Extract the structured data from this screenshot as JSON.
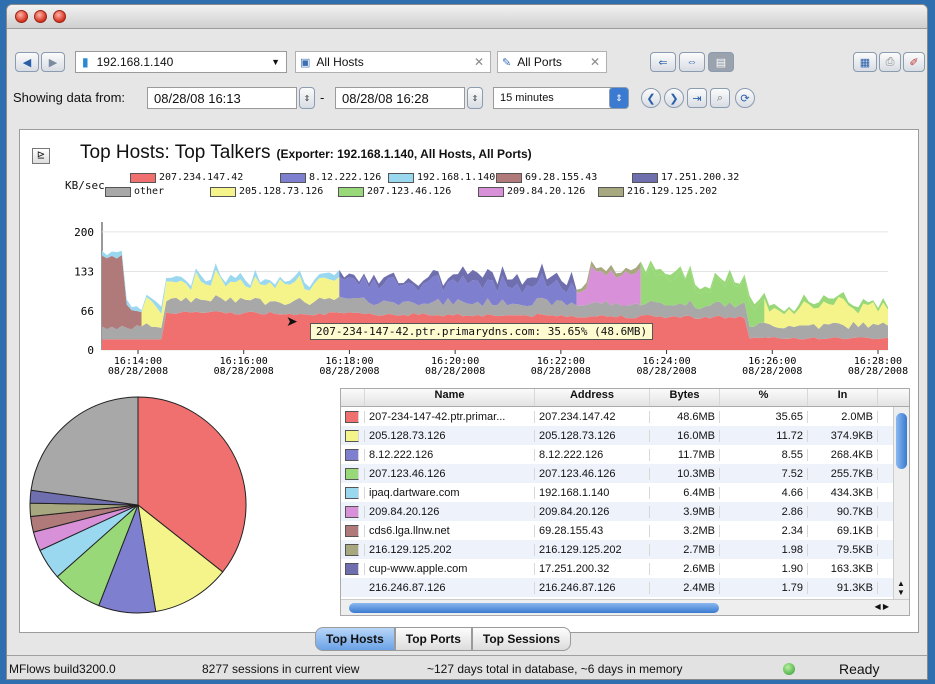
{
  "toolbar": {
    "exporter": "192.168.1.140",
    "hosts_tab": "All Hosts",
    "ports_tab": "All Ports"
  },
  "range": {
    "label": "Showing data from:",
    "from": "08/28/08 16:13",
    "dash": "-",
    "to": "08/28/08 16:28",
    "interval": "15 minutes"
  },
  "report": {
    "title": "Top Hosts: Top Talkers",
    "subtitle": "(Exporter: 192.168.1.140, All Hosts, All Ports)"
  },
  "tooltip": "207-234-147-42.ptr.primarydns.com: 35.65% (48.6MB)",
  "chart_data": {
    "type": "area",
    "ylabel": "KB/sec",
    "yticks": [
      "200",
      "133",
      "66",
      "0"
    ],
    "ylim": [
      0,
      210
    ],
    "x_ticks": [
      {
        "time": "16:14:00",
        "date": "08/28/2008"
      },
      {
        "time": "16:16:00",
        "date": "08/28/2008"
      },
      {
        "time": "16:18:00",
        "date": "08/28/2008"
      },
      {
        "time": "16:20:00",
        "date": "08/28/2008"
      },
      {
        "time": "16:22:00",
        "date": "08/28/2008"
      },
      {
        "time": "16:24:00",
        "date": "08/28/2008"
      },
      {
        "time": "16:26:00",
        "date": "08/28/2008"
      },
      {
        "time": "16:28:00",
        "date": "08/28/2008"
      }
    ],
    "legend_row1": [
      {
        "name": "207.234.147.42",
        "color": "#f07070"
      },
      {
        "name": "8.12.222.126",
        "color": "#7f7fd0"
      },
      {
        "name": "192.168.1.140",
        "color": "#9ad8f0"
      },
      {
        "name": "69.28.155.43",
        "color": "#b07a7a"
      },
      {
        "name": "17.251.200.32",
        "color": "#6f6fb0"
      }
    ],
    "legend_row2": [
      {
        "name": "other",
        "color": "#a8a8a8"
      },
      {
        "name": "205.128.73.126",
        "color": "#f4f48a"
      },
      {
        "name": "207.123.46.126",
        "color": "#98d878"
      },
      {
        "name": "209.84.20.126",
        "color": "#d890d8"
      },
      {
        "name": "216.129.125.202",
        "color": "#a8a880"
      }
    ],
    "pie": [
      {
        "name": "207-234-147-42.ptr.primar...",
        "value": 35.65,
        "color": "#f07070"
      },
      {
        "name": "205.128.73.126",
        "value": 11.72,
        "color": "#f4f48a"
      },
      {
        "name": "8.12.222.126",
        "value": 8.55,
        "color": "#7f7fd0"
      },
      {
        "name": "207.123.46.126",
        "value": 7.52,
        "color": "#98d878"
      },
      {
        "name": "ipaq.dartware.com",
        "value": 4.66,
        "color": "#9ad8f0"
      },
      {
        "name": "209.84.20.126",
        "value": 2.86,
        "color": "#d890d8"
      },
      {
        "name": "cds6.lga.llnw.net",
        "value": 2.34,
        "color": "#b07a7a"
      },
      {
        "name": "216.129.125.202",
        "value": 1.98,
        "color": "#a8a880"
      },
      {
        "name": "cup-www.apple.com",
        "value": 1.9,
        "color": "#6f6fb0"
      },
      {
        "name": "other",
        "value": 22.82,
        "color": "#a8a8a8"
      }
    ]
  },
  "table": {
    "headers": [
      "Name",
      "Address",
      "Bytes",
      "%",
      "In"
    ],
    "rows": [
      {
        "color": "#f07070",
        "name": "207-234-147-42.ptr.primar...",
        "address": "207.234.147.42",
        "bytes": "48.6MB",
        "pct": "35.65",
        "in": "2.0MB"
      },
      {
        "color": "#f4f48a",
        "name": "205.128.73.126",
        "address": "205.128.73.126",
        "bytes": "16.0MB",
        "pct": "11.72",
        "in": "374.9KB"
      },
      {
        "color": "#7f7fd0",
        "name": "8.12.222.126",
        "address": "8.12.222.126",
        "bytes": "11.7MB",
        "pct": "8.55",
        "in": "268.4KB"
      },
      {
        "color": "#98d878",
        "name": "207.123.46.126",
        "address": "207.123.46.126",
        "bytes": "10.3MB",
        "pct": "7.52",
        "in": "255.7KB"
      },
      {
        "color": "#9ad8f0",
        "name": "ipaq.dartware.com",
        "address": "192.168.1.140",
        "bytes": "6.4MB",
        "pct": "4.66",
        "in": "434.3KB"
      },
      {
        "color": "#d890d8",
        "name": "209.84.20.126",
        "address": "209.84.20.126",
        "bytes": "3.9MB",
        "pct": "2.86",
        "in": "90.7KB"
      },
      {
        "color": "#b07a7a",
        "name": "cds6.lga.llnw.net",
        "address": "69.28.155.43",
        "bytes": "3.2MB",
        "pct": "2.34",
        "in": "69.1KB"
      },
      {
        "color": "#a8a880",
        "name": "216.129.125.202",
        "address": "216.129.125.202",
        "bytes": "2.7MB",
        "pct": "1.98",
        "in": "79.5KB"
      },
      {
        "color": "#6f6fb0",
        "name": "cup-www.apple.com",
        "address": "17.251.200.32",
        "bytes": "2.6MB",
        "pct": "1.90",
        "in": "163.3KB"
      },
      {
        "color": "",
        "name": "216.246.87.126",
        "address": "216.246.87.126",
        "bytes": "2.4MB",
        "pct": "1.79",
        "in": "91.3KB"
      }
    ]
  },
  "bottom_tabs": [
    "Top Hosts",
    "Top Ports",
    "Top Sessions"
  ],
  "status": {
    "build": "MFlows build3200.0",
    "sessions": "8277 sessions in current view",
    "days": "~127 days total in database, ~6 days in memory",
    "ready": "Ready"
  }
}
